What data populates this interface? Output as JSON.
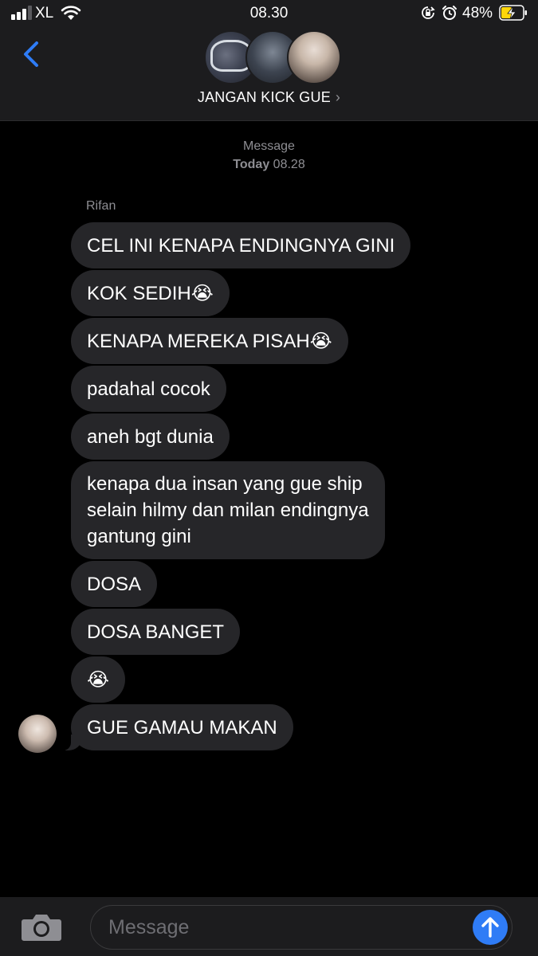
{
  "status_bar": {
    "carrier": "XL",
    "time": "08.30",
    "battery_percent": "48%",
    "signal_bars": 3,
    "signal_bars_max": 4,
    "icons": [
      "signal-icon",
      "wifi-icon",
      "orientation-lock-icon",
      "alarm-icon",
      "battery-charging-icon"
    ]
  },
  "header": {
    "back_icon": "chevron-left-icon",
    "group_name": "JANGAN KICK GUE",
    "group_chevron": "›",
    "avatar_count": 3
  },
  "conversation": {
    "timestamp_service": "Message",
    "timestamp_day": "Today",
    "timestamp_time": "08.28",
    "sender": "Rifan",
    "messages": [
      "CEL INI KENAPA ENDINGNYA GINI",
      "KOK SEDIH😭",
      "KENAPA MEREKA PISAH😭",
      "padahal cocok",
      "aneh bgt dunia",
      "kenapa dua insan yang gue ship\nselain hilmy dan milan endingnya\ngantung gini",
      "DOSA",
      "DOSA BANGET",
      "😭",
      "GUE GAMAU MAKAN"
    ]
  },
  "composer": {
    "placeholder": "Message",
    "camera_icon": "camera-icon",
    "send_icon": "arrow-up-icon"
  },
  "colors": {
    "background": "#000000",
    "bar_background": "#1c1c1e",
    "bubble": "#262629",
    "accent": "#2f7cf6",
    "secondary_text": "#8e8e93",
    "battery_charge": "#ffd60a"
  }
}
